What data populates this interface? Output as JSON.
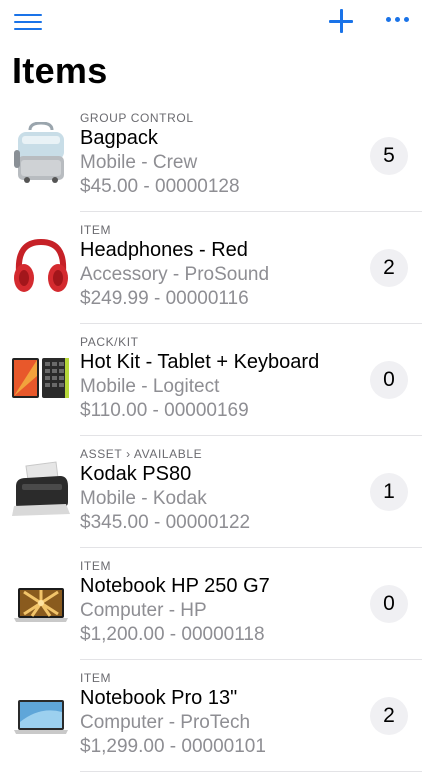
{
  "header": {
    "title": "Items",
    "menu_icon": "hamburger-menu-icon",
    "add_icon": "plus-icon",
    "more_icon": "ellipsis-icon",
    "accent": "#1a73e8"
  },
  "items": [
    {
      "kind": "GROUP CONTROL",
      "name": "Bagpack",
      "subtitle": "Mobile - Crew",
      "price_line": "$45.00 - 00000128",
      "count": "5",
      "icon": "backpack-icon"
    },
    {
      "kind": "ITEM",
      "name": "Headphones - Red",
      "subtitle": "Accessory - ProSound",
      "price_line": "$249.99 - 00000116",
      "count": "2",
      "icon": "headphones-icon"
    },
    {
      "kind": "PACK/KIT",
      "name": "Hot Kit - Tablet + Keyboard",
      "subtitle": "Mobile - Logitect",
      "price_line": "$110.00 - 00000169",
      "count": "0",
      "icon": "tablet-keyboard-icon"
    },
    {
      "kind": "ASSET › AVAILABLE",
      "name": "Kodak PS80",
      "subtitle": "Mobile - Kodak",
      "price_line": "$345.00 - 00000122",
      "count": "1",
      "icon": "scanner-icon"
    },
    {
      "kind": "ITEM",
      "name": "Notebook HP 250 G7",
      "subtitle": "Computer - HP",
      "price_line": "$1,200.00 - 00000118",
      "count": "0",
      "icon": "laptop-icon"
    },
    {
      "kind": "ITEM",
      "name": "Notebook Pro 13\"",
      "subtitle": "Computer - ProTech",
      "price_line": "$1,299.00 - 00000101",
      "count": "2",
      "icon": "laptop-silver-icon"
    }
  ]
}
